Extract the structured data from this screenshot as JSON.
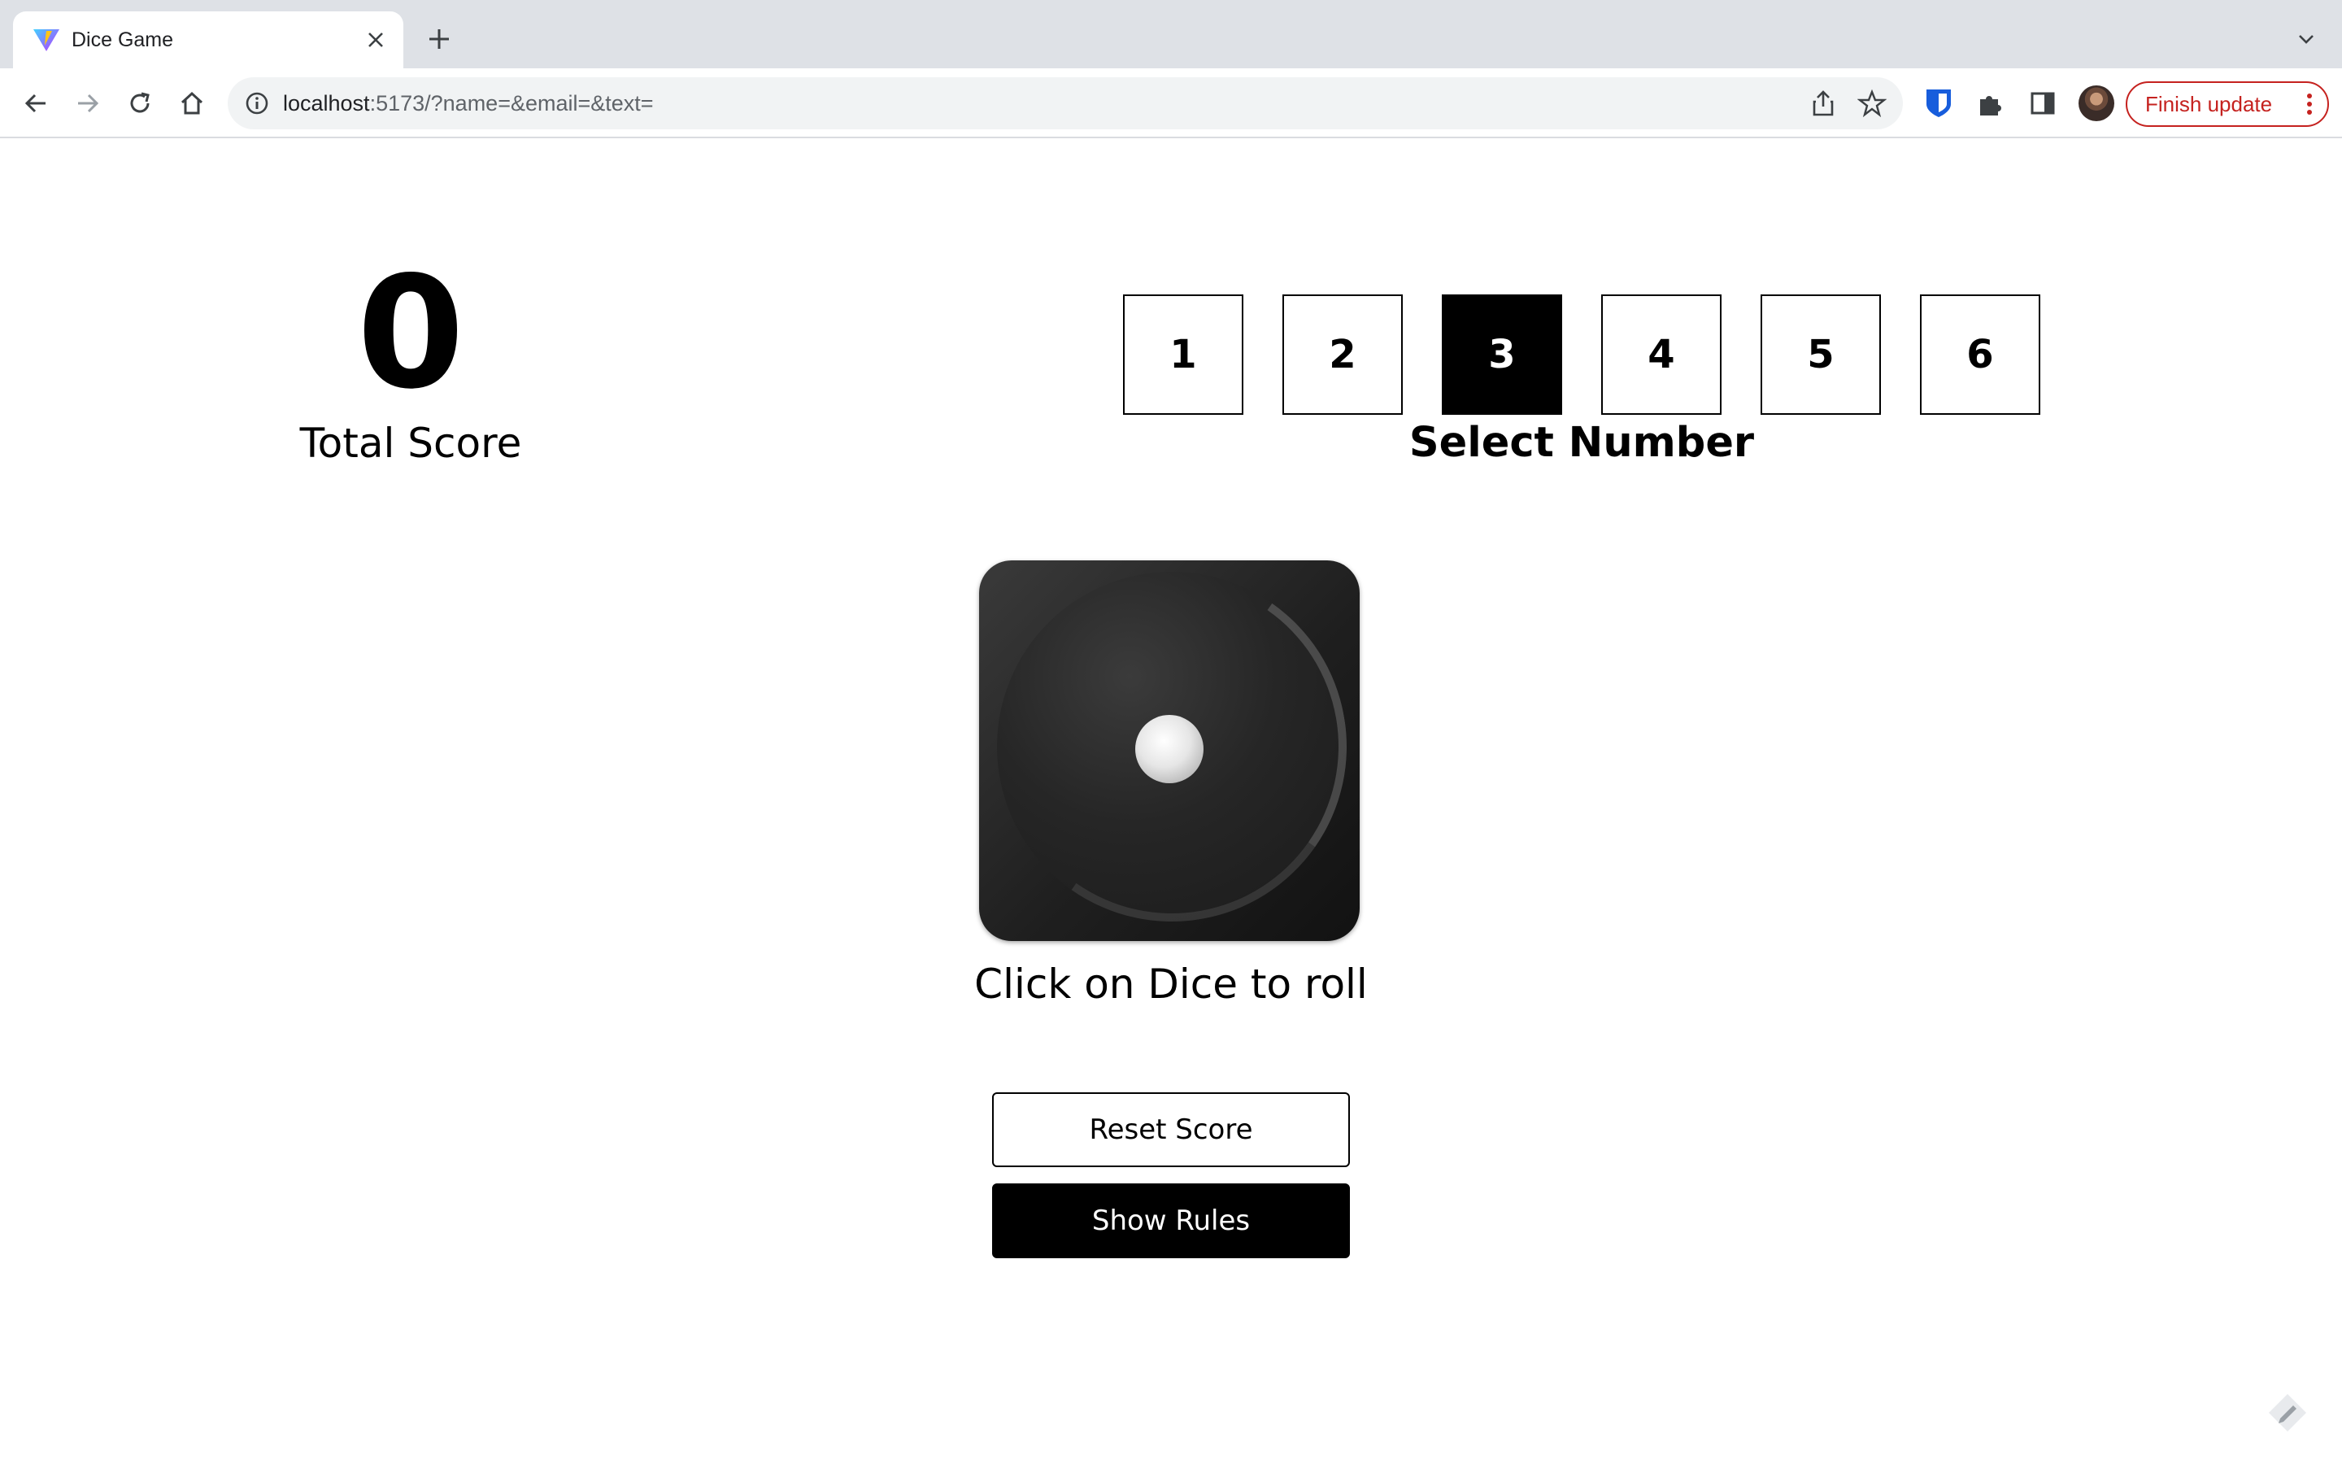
{
  "browser": {
    "tab_title": "Dice Game",
    "url_host": "localhost",
    "url_rest": ":5173/?name=&email=&text=",
    "update_button": "Finish update",
    "colors": {
      "tabstrip": "#dee1e6",
      "update_accent": "#c5221f"
    },
    "icons": [
      "back-icon",
      "forward-icon",
      "reload-icon",
      "home-icon",
      "info-icon",
      "share-icon",
      "star-icon",
      "bitwarden-icon",
      "extensions-icon",
      "sidepanel-icon",
      "more-icon"
    ]
  },
  "game": {
    "total_score": "0",
    "total_score_label": "Total Score",
    "numbers": [
      "1",
      "2",
      "3",
      "4",
      "5",
      "6"
    ],
    "selected_number": "3",
    "select_label": "Select Number",
    "dice_value": 1,
    "roll_hint": "Click on Dice to roll",
    "reset_button": "Reset Score",
    "rules_button": "Show Rules"
  }
}
